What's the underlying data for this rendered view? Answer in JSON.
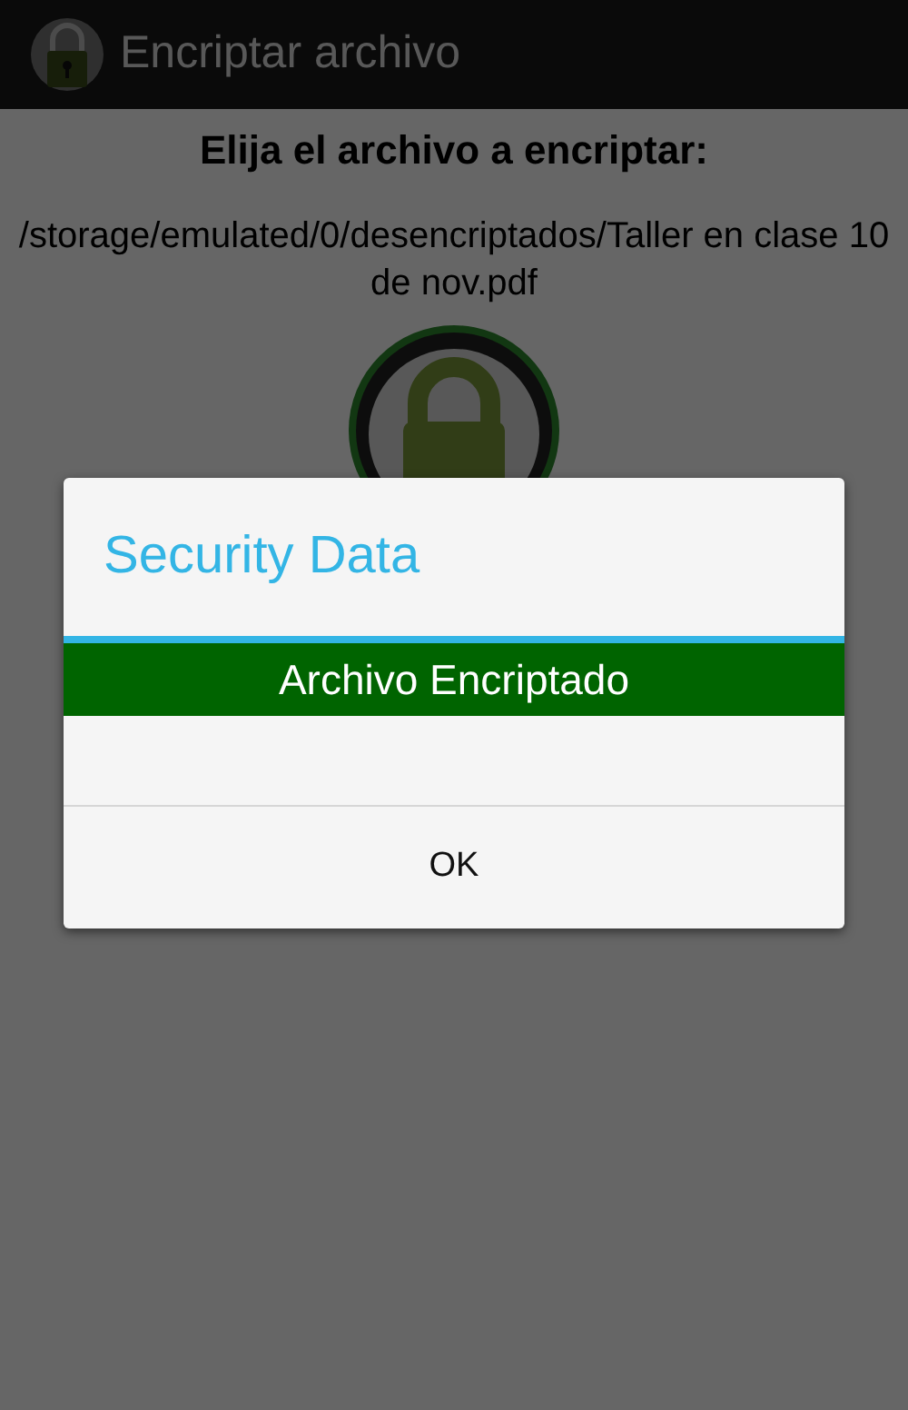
{
  "app_bar": {
    "title": "Encriptar archivo"
  },
  "prompt": "Elija el archivo a encriptar:",
  "file_path": "/storage/emulated/0/desencriptados/Taller en clase 10 de nov.pdf",
  "dialog": {
    "title": "Security Data",
    "message": "Archivo Encriptado",
    "buttons": [
      "OK"
    ]
  }
}
